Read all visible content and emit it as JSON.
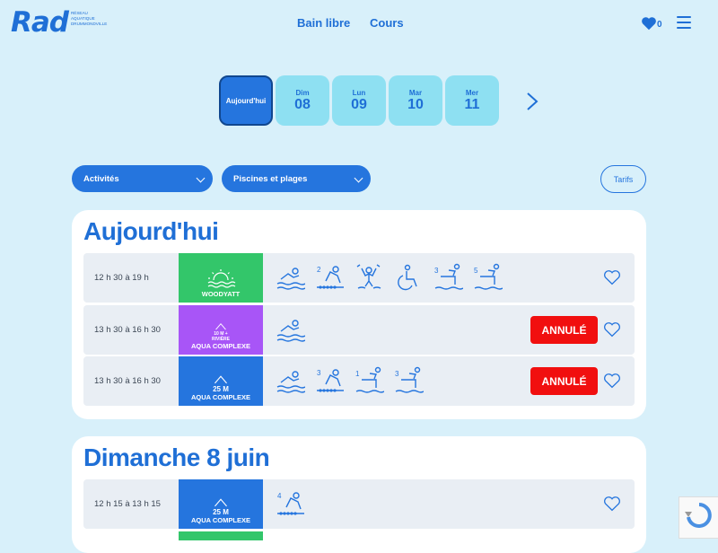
{
  "header": {
    "logo_text": "Rad",
    "logo_sub": [
      "Réseau",
      "Aquatique",
      "Drummondville"
    ],
    "nav": [
      "Bain libre",
      "Cours"
    ],
    "favorites_count": "0"
  },
  "date_tabs": [
    {
      "label": "Aujourd'hui",
      "num": ""
    },
    {
      "label": "Dim",
      "num": "08"
    },
    {
      "label": "Lun",
      "num": "09"
    },
    {
      "label": "Mar",
      "num": "10"
    },
    {
      "label": "Mer",
      "num": "11"
    }
  ],
  "filters": {
    "activities": "Activités",
    "pools": "Piscines et plages",
    "tarifs": "Tarifs"
  },
  "sections": [
    {
      "title": "Aujourd'hui",
      "rows": [
        {
          "time": "12 h 30 à 19 h",
          "badge_name": "WOODYATT",
          "badge_color": "#33c66a",
          "annule": ""
        },
        {
          "time": "13 h 30 à 16 h 30",
          "badge_sub": [
            "10 M +",
            "RIVIÈRE"
          ],
          "badge_name": "AQUA COMPLEXE",
          "badge_color": "#a855f7",
          "annule": "ANNULÉ"
        },
        {
          "time": "13 h 30 à 16 h 30",
          "badge_size": "25 M",
          "badge_name": "AQUA COMPLEXE",
          "badge_color": "#2575de",
          "annule": "ANNULÉ"
        }
      ]
    },
    {
      "title": "Dimanche 8 juin",
      "rows": [
        {
          "time": "12 h 15 à 13 h 15",
          "badge_size": "25 M",
          "badge_name": "AQUA COMPLEXE",
          "badge_color": "#2575de",
          "annule": ""
        }
      ]
    }
  ],
  "icon_numbers": {
    "lanes_2": "2",
    "lanes_4": "4",
    "board_3": "3",
    "board_5": "5",
    "board_1": "1"
  },
  "colors": {
    "primary": "#1f6fd6",
    "background": "#d8f0fa",
    "date_tab": "#8ee0f2",
    "woodyatt": "#33c66a",
    "riviere": "#a855f7",
    "annule": "#f10f0f"
  }
}
